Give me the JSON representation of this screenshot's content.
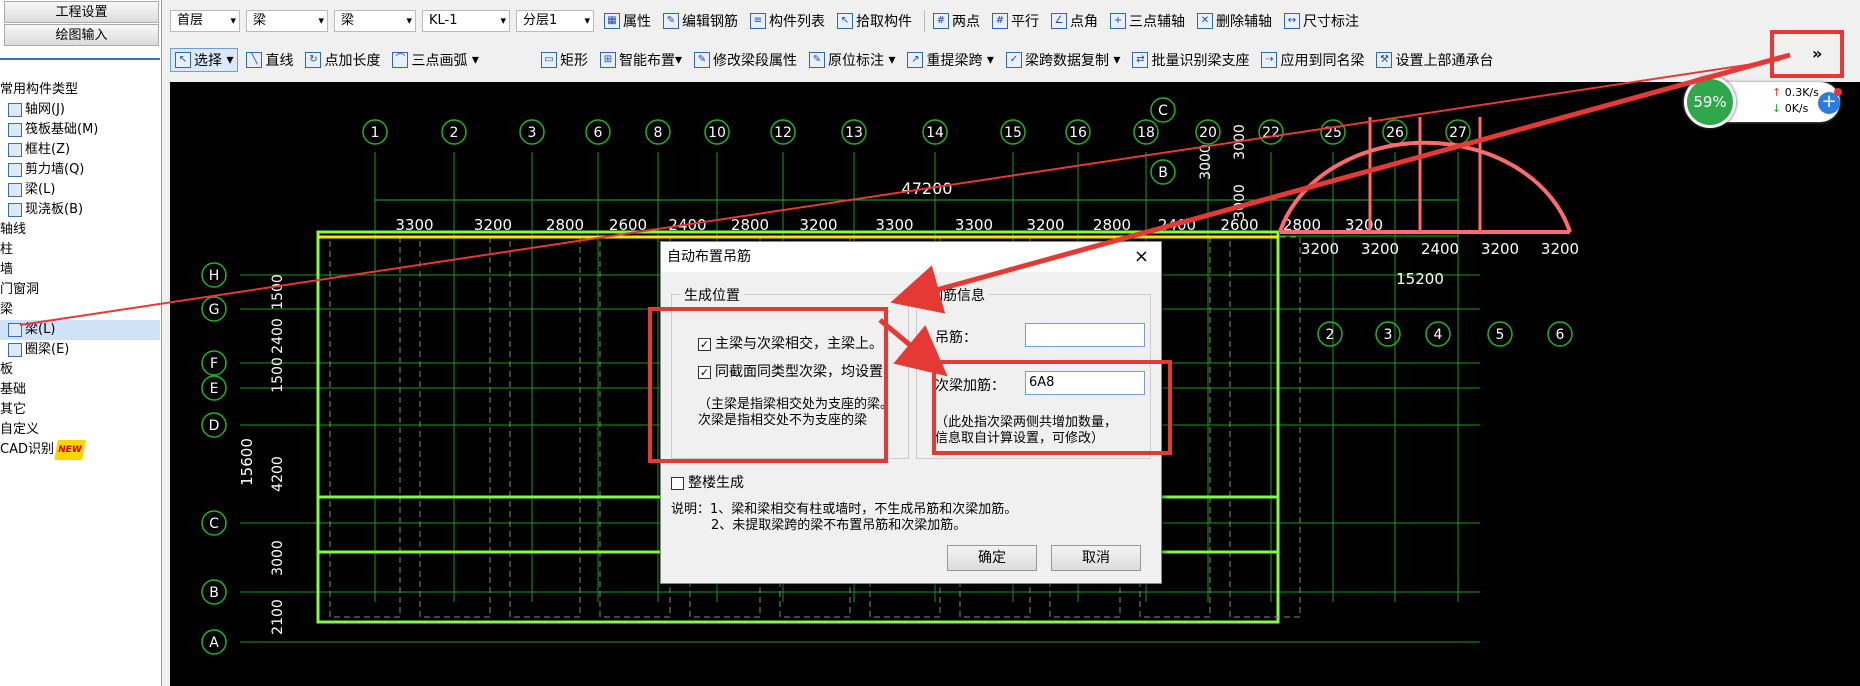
{
  "left": {
    "btn1": "工程设置",
    "btn2": "绘图输入",
    "items": [
      "常用构件类型",
      "轴网(J)",
      "筏板基础(M)",
      "框柱(Z)",
      "剪力墙(Q)",
      "梁(L)",
      "现浇板(B)",
      "轴线",
      "柱",
      "墙",
      "门窗洞",
      "梁",
      "梁(L)",
      "圈梁(E)",
      "板",
      "基础",
      "其它",
      "自定义",
      "CAD识别"
    ],
    "new_badge": "NEW"
  },
  "toolbar1": {
    "combos": [
      "首层",
      "梁",
      "梁",
      "KL-1",
      "分层1"
    ],
    "buttons": [
      "属性",
      "编辑钢筋",
      "构件列表",
      "拾取构件",
      "两点",
      "平行",
      "点角",
      "三点辅轴",
      "删除辅轴",
      "尺寸标注"
    ]
  },
  "toolbar2": {
    "buttons": [
      "选择",
      "直线",
      "点加长度",
      "三点画弧",
      "矩形",
      "智能布置",
      "修改梁段属性",
      "原位标注",
      "重提梁跨",
      "梁跨数据复制",
      "批量识别梁支座",
      "应用到同名梁",
      "设置上部通承台"
    ],
    "more": "»"
  },
  "speed": {
    "percent": "59%",
    "up": "0.3K/s",
    "down": "0K/s",
    "plus": "+"
  },
  "dialog": {
    "title": "自动布置吊筋",
    "close": "×",
    "group1": "生成位置",
    "chk1": "主梁与次梁相交，主梁上。",
    "chk2": "同截面同类型次梁，均设置",
    "note1": "（主梁是指梁相交处为支座的梁。",
    "note2": "次梁是指相交处不为支座的梁",
    "group2": "钢筋信息",
    "lbl_hang": "吊筋：",
    "hang_value": "",
    "lbl_extra": "次梁加筋：",
    "extra_value": "6A8",
    "note3": "（此处指次梁两侧共增加数量，",
    "note4": "信息取自计算设置，可修改）",
    "chk3": "整楼生成",
    "exp1": "说明：1、梁和梁相交有柱或墙时，不生成吊筋和次梁加筋。",
    "exp2": "2、未提取梁跨的梁不布置吊筋和次梁加筋。",
    "ok": "确定",
    "cancel": "取消"
  },
  "cad": {
    "axis_top": [
      "1",
      "2",
      "3",
      "6",
      "8",
      "10",
      "12",
      "13",
      "14",
      "15",
      "16",
      "18",
      "20",
      "22",
      "25",
      "26",
      "27"
    ],
    "total_width": "47200",
    "spans": [
      "3300",
      "3200",
      "2800",
      "2600",
      "2400",
      "2800",
      "3200",
      "3300",
      "3300",
      "3200",
      "2800",
      "2400",
      "2600",
      "2800",
      "3200"
    ],
    "rows_left": [
      "H",
      "G",
      "F",
      "E",
      "D",
      "C",
      "B",
      "A"
    ],
    "dims_left": [
      "1500",
      "2400",
      "1500",
      "4200",
      "3000",
      "2100"
    ],
    "total_height": "15600",
    "right_axes": [
      "2",
      "3",
      "4",
      "5",
      "6"
    ],
    "right_spans": [
      "3200",
      "3200",
      "2400",
      "3200",
      "3200"
    ],
    "right_total": "15200",
    "right_top": [
      "C",
      "B"
    ],
    "right_dims": [
      "3000",
      "3000",
      "3000"
    ]
  }
}
